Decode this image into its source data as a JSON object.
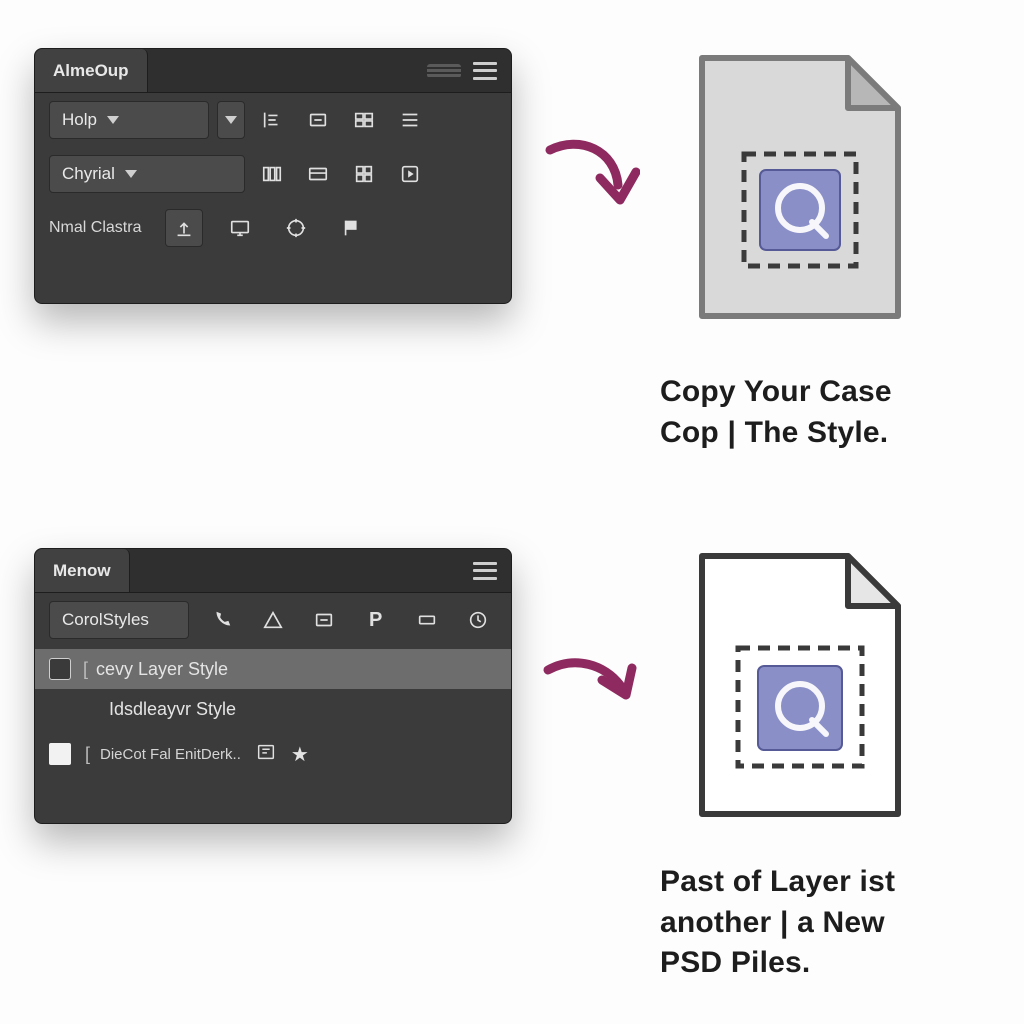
{
  "panelA": {
    "tab": "AlmeOup",
    "dropdown1": "Holp",
    "dropdown2": "Chyrial",
    "static_label": "Nmal Clastra"
  },
  "panelB": {
    "tab": "Menow",
    "dropdown": "CorolStyles",
    "item_active": "cevy Layer Style",
    "item_secondary": "Idsdleayvr Style",
    "footer_text": "DieCot Fal EnitDerk.."
  },
  "captions": {
    "top_line1": "Copy Your Case",
    "top_line2": "Cop | The Style.",
    "bottom_line1": "Past of Layer ist",
    "bottom_line2": "another | a New",
    "bottom_line3": "PSD Piles."
  },
  "colors": {
    "panel_bg": "#3b3b3b",
    "arrow": "#8e2a5f",
    "file_fill_top": "#d9d9d9",
    "file_fill_bottom": "#ffffff",
    "swatch": "#8a8fc8"
  }
}
